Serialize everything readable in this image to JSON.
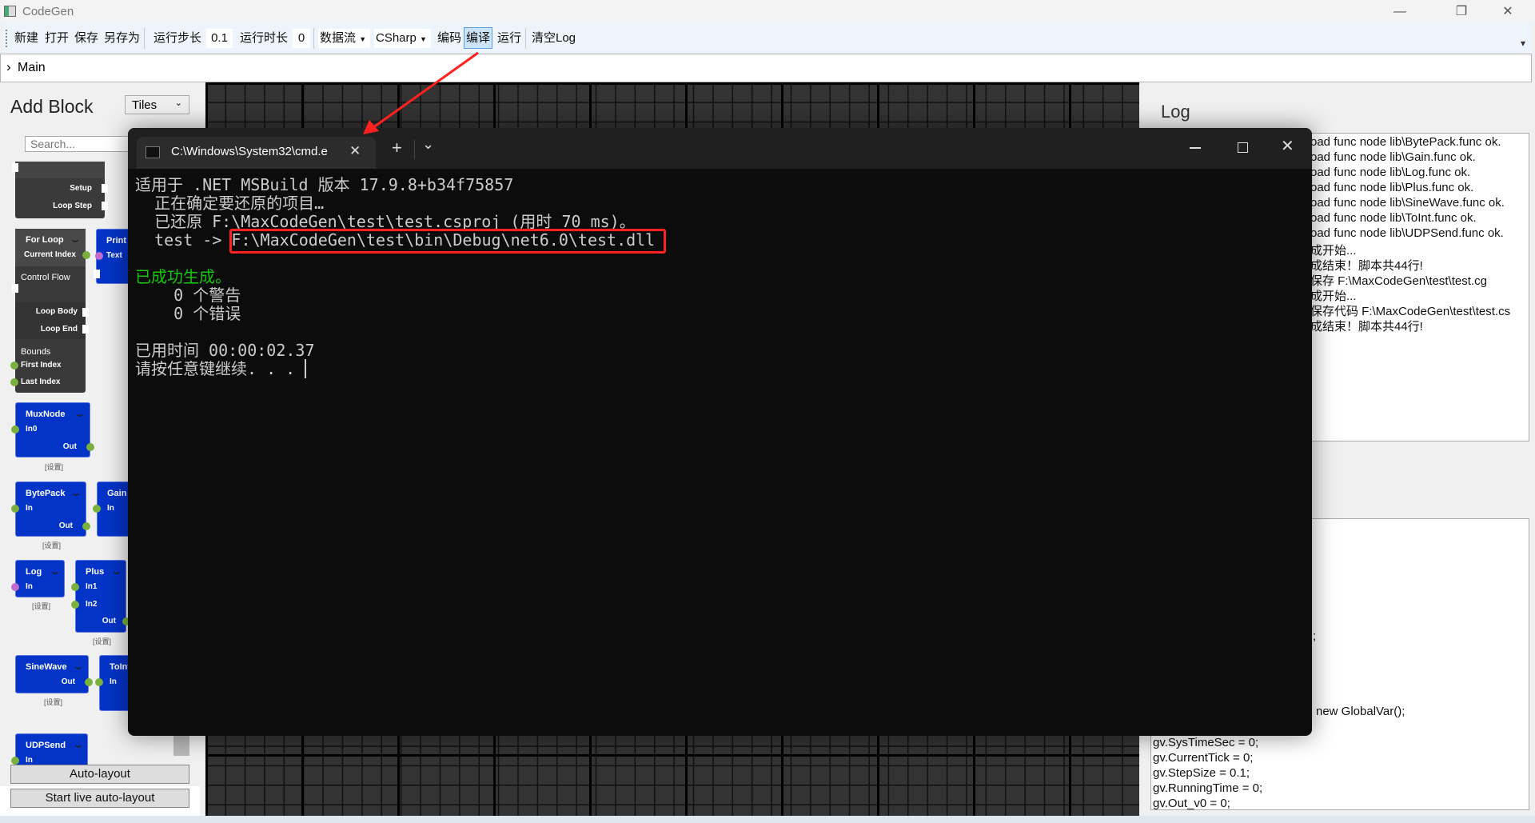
{
  "window": {
    "title": "CodeGen",
    "min": "—",
    "max": "❐",
    "close": "✕"
  },
  "toolbar": {
    "new": "新建",
    "open": "打开",
    "save": "保存",
    "save_as": "另存为",
    "step_label": "运行步长",
    "step_value": "0.1",
    "time_label": "运行时长",
    "time_value": "0",
    "dataflow": "数据流",
    "language": "CSharp",
    "encode": "编码",
    "compile": "编译",
    "run": "运行",
    "clear_log": "清空Log",
    "overflow": "▾"
  },
  "breadcrumb": {
    "chevron": "›",
    "label": "Main"
  },
  "left": {
    "title": "Add Block",
    "view_select": "Tiles",
    "search_placeholder": "Search...",
    "settings": "[设置]",
    "blocks": {
      "setup": {
        "ports": [
          "Setup",
          "Loop Step"
        ]
      },
      "for_loop": {
        "title": "For Loop",
        "current": "Current Index",
        "control": "Control Flow",
        "body": "Loop Body",
        "end": "Loop End",
        "bounds": "Bounds",
        "first": "First Index",
        "last": "Last Index"
      },
      "print": {
        "title": "Print",
        "in": "Text"
      },
      "mux": {
        "title": "MuxNode",
        "in": "In0",
        "out": "Out"
      },
      "bytepack": {
        "title": "BytePack",
        "in": "In",
        "out": "Out"
      },
      "gain": {
        "title": "Gain",
        "in": "In"
      },
      "log": {
        "title": "Log",
        "in": "In"
      },
      "plus": {
        "title": "Plus",
        "in1": "In1",
        "in2": "In2",
        "out": "Out"
      },
      "sine": {
        "title": "SineWave",
        "out": "Out"
      },
      "toint": {
        "title": "ToInt",
        "in": "In"
      },
      "udp": {
        "title": "UDPSend",
        "in": "In"
      }
    },
    "auto_layout": "Auto-layout",
    "live_layout": "Start live auto-layout"
  },
  "log": {
    "title": "Log",
    "lines": [
      "oad func node lib\\BytePack.func ok.",
      "oad func node lib\\Gain.func ok.",
      "oad func node lib\\Log.func ok.",
      "oad func node lib\\Plus.func ok.",
      "oad func node lib\\SineWave.func ok.",
      "oad func node lib\\ToInt.func ok.",
      "oad func node lib\\UDPSend.func ok.",
      "成开始...",
      "成结束！脚本共44行!",
      "保存 F:\\MaxCodeGen\\test\\test.cg",
      "成开始...",
      "保存代码 F:\\MaxCodeGen\\test\\test.cs",
      "成结束！脚本共44行!"
    ]
  },
  "code": {
    "partial1": ";",
    "partial2": "new GlobalVar();",
    "lines": [
      "gv.SysTimeSec = 0;",
      "gv.CurrentTick = 0;",
      "gv.StepSize = 0.1;",
      "gv.RunningTime = 0;",
      "gv.Out_v0 = 0;"
    ]
  },
  "terminal": {
    "tab_title": "C:\\Windows\\System32\\cmd.e",
    "new_tab": "+",
    "dropdown": "⌄",
    "lines": [
      "适用于 .NET MSBuild 版本 17.9.8+b34f75857",
      "  正在确定要还原的项目…",
      "  已还原 F:\\MaxCodeGen\\test\\test.csproj (用时 70 ms)。"
    ],
    "output_prefix": "  test -> ",
    "output_path": "F:\\MaxCodeGen\\test\\bin\\Debug\\net6.0\\test.dll",
    "success": "已成功生成。",
    "warnings": "    0 个警告",
    "errors": "    0 个错误",
    "elapsed": "已用时间 00:00:02.37",
    "prompt": "请按任意键继续. . . "
  },
  "colors": {
    "annotation": "#ff2020",
    "success": "#16c60c",
    "block_blue": "#0433c8",
    "port_green": "#7ab13e",
    "port_purple": "#c06ad0"
  }
}
